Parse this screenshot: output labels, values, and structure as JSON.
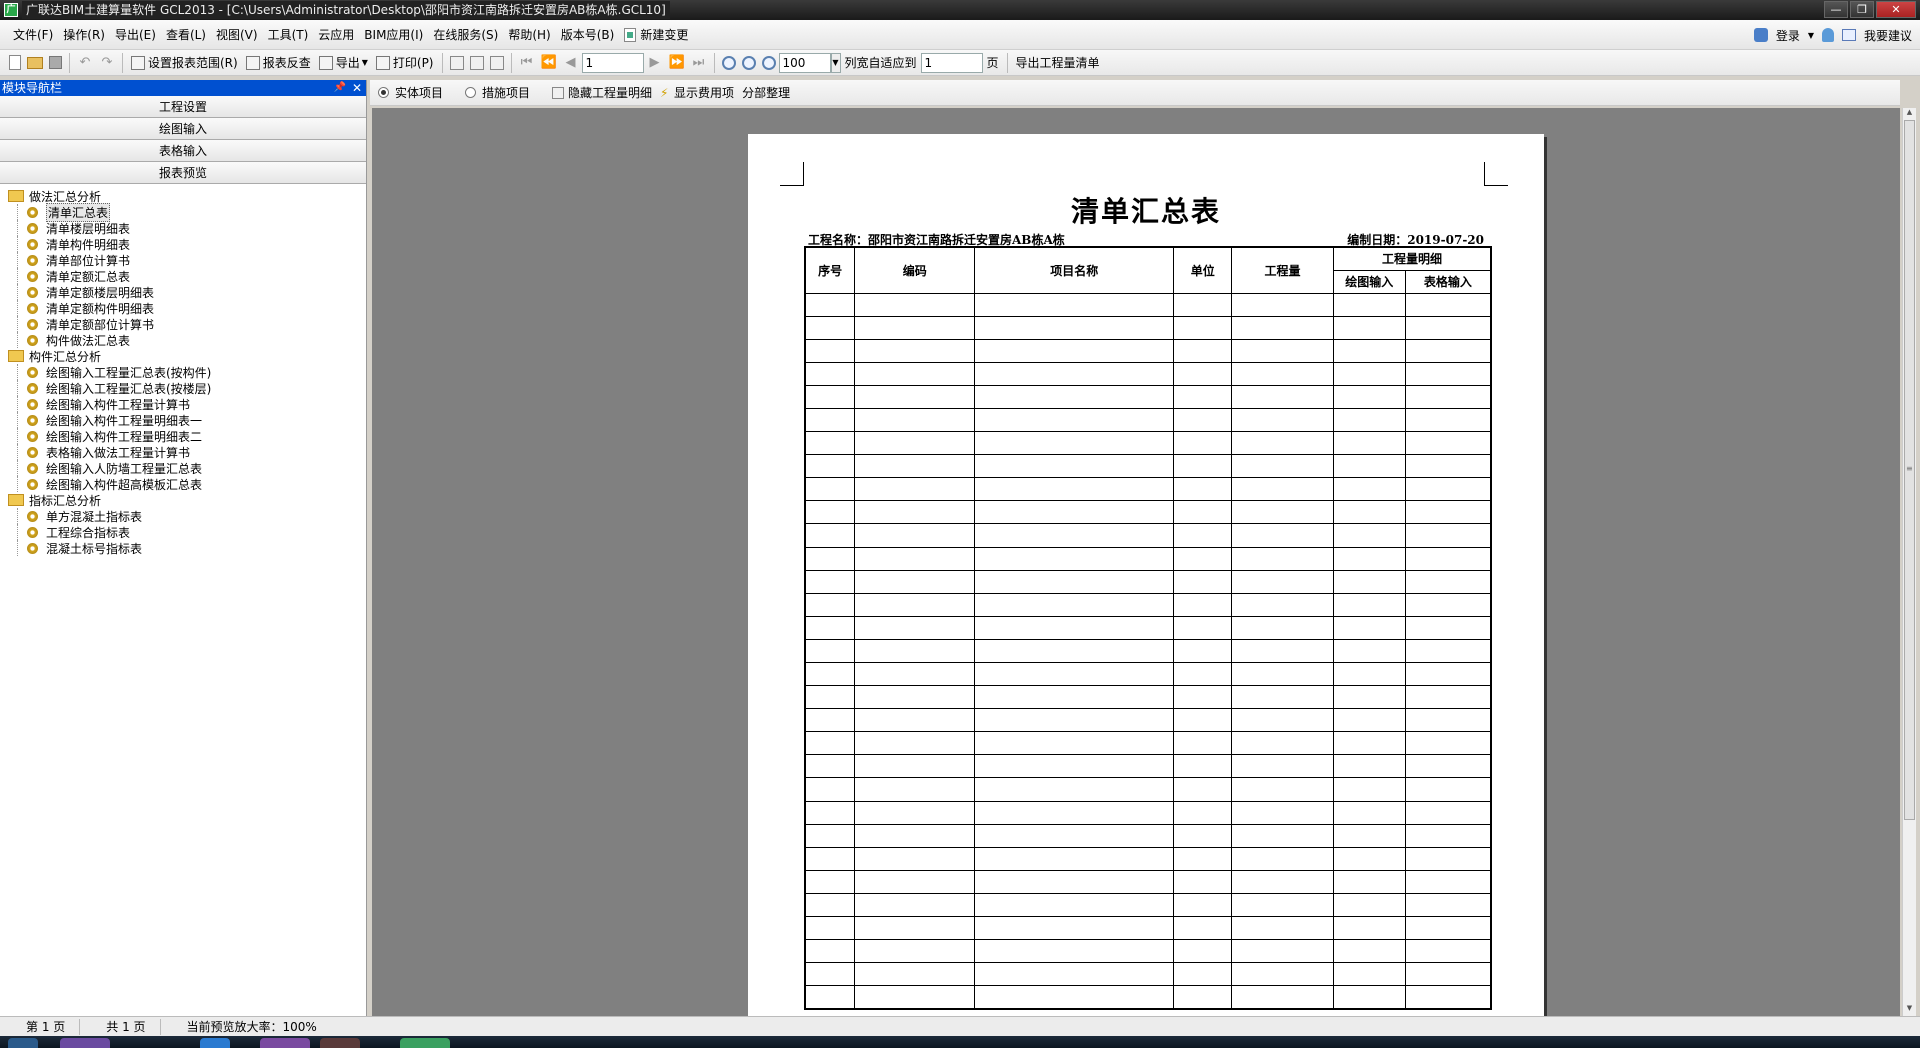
{
  "window": {
    "title": "广联达BIM土建算量软件 GCL2013 - [C:\\Users\\Administrator\\Desktop\\邵阳市资江南路拆迁安置房AB栋A栋.GCL10]",
    "app_icon": "广"
  },
  "menu": {
    "items": [
      "文件(F)",
      "操作(R)",
      "导出(E)",
      "查看(L)",
      "视图(V)",
      "工具(T)",
      "云应用",
      "BIM应用(I)",
      "在线服务(S)",
      "帮助(H)",
      "版本号(B)"
    ],
    "new_change": "新建变更",
    "login": "登录",
    "suggest": "我要建议"
  },
  "toolbar": {
    "set_range": "设置报表范围(R)",
    "reverse_check": "报表反查",
    "export": "导出",
    "print": "打印(P)",
    "page_value": "1",
    "zoom_value": "100",
    "fit_width": "列宽自适应到",
    "fit_value": "1",
    "page_unit": "页",
    "export_list": "导出工程量清单"
  },
  "nav_panel": {
    "title": "模块导航栏",
    "pin_icon": "pin-icon",
    "buttons": [
      "工程设置",
      "绘图输入",
      "表格输入",
      "报表预览"
    ],
    "groups": [
      {
        "label": "做法汇总分析",
        "items": [
          "清单汇总表",
          "清单楼层明细表",
          "清单构件明细表",
          "清单部位计算书",
          "清单定额汇总表",
          "清单定额楼层明细表",
          "清单定额构件明细表",
          "清单定额部位计算书",
          "构件做法汇总表"
        ]
      },
      {
        "label": "构件汇总分析",
        "items": [
          "绘图输入工程量汇总表(按构件)",
          "绘图输入工程量汇总表(按楼层)",
          "绘图输入构件工程量计算书",
          "绘图输入构件工程量明细表一",
          "绘图输入构件工程量明细表二",
          "表格输入做法工程量计算书",
          "绘图输入人防墙工程量汇总表",
          "绘图输入构件超高模板汇总表"
        ]
      },
      {
        "label": "指标汇总分析",
        "items": [
          "单方混凝土指标表",
          "工程综合指标表",
          "混凝土标号指标表"
        ]
      }
    ],
    "selected": "清单汇总表"
  },
  "preview_bar": {
    "radio_entity": "实体项目",
    "radio_measure": "措施项目",
    "hide_detail": "隐藏工程量明细",
    "show_cost": "显示费用项",
    "section_sort": "分部整理"
  },
  "report": {
    "title": "清单汇总表",
    "project": "工程名称：邵阳市资江南路拆迁安置房AB栋A栋",
    "date": "编制日期：2019-07-20",
    "headers": {
      "seq": "序号",
      "code": "编码",
      "name": "项目名称",
      "unit": "单位",
      "qty": "工程量",
      "detail": "工程量明细",
      "draw_input": "绘图输入",
      "table_input": "表格输入"
    },
    "empty_rows": 31
  },
  "status": {
    "page": "第 1 页",
    "total": "共 1 页",
    "zoom": "当前预览放大率：100%"
  }
}
